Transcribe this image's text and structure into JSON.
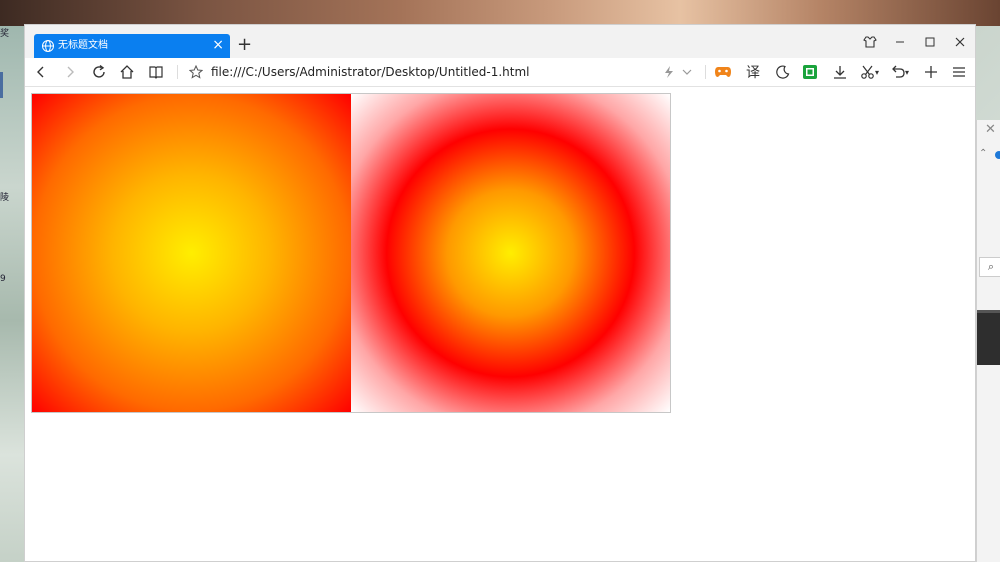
{
  "desktop": {
    "left_labels": [
      "奖",
      "陵",
      "9"
    ]
  },
  "browser": {
    "tab": {
      "title": "无标题文档"
    },
    "address": {
      "url": "file:///C:/Users/Administrator/Desktop/Untitled-1.html"
    },
    "toolbar": {
      "translate_label": "译"
    },
    "colors": {
      "tab_blue": "#0a7ff0",
      "gradient_center": "#ffee00",
      "gradient_edge": "#ff0000",
      "game_icon_orange": "#f0841a",
      "green_icon": "#1aa33c"
    }
  },
  "icons": [
    "globe-icon",
    "close-icon",
    "plus-icon",
    "shirt-icon",
    "minimize-icon",
    "maximize-icon",
    "back-icon",
    "forward-icon",
    "reload-icon",
    "home-icon",
    "reader-icon",
    "star-icon",
    "lightning-icon",
    "chevron-down-icon",
    "gamepad-icon",
    "moon-icon",
    "screenshot-icon",
    "download-icon",
    "scissors-icon",
    "undo-icon",
    "menu-icon"
  ]
}
